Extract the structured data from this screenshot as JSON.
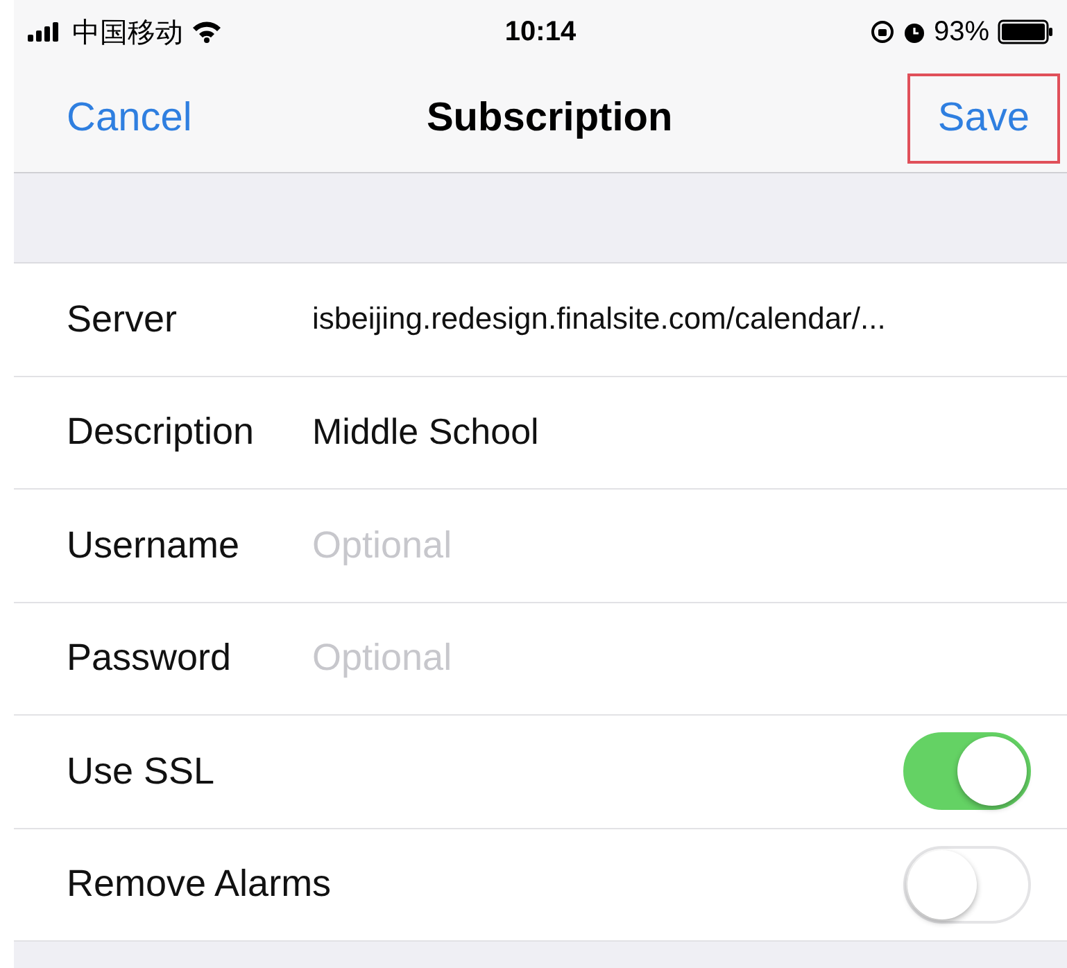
{
  "status_bar": {
    "carrier": "中国移动",
    "time": "10:14",
    "battery": "93%"
  },
  "nav": {
    "cancel": "Cancel",
    "title": "Subscription",
    "save": {
      "label": "Save",
      "highlighted": true
    }
  },
  "rows": [
    {
      "kind": "text",
      "label": "Server",
      "value": "isbeijing.redesign.finalsite.com/calendar/..."
    },
    {
      "kind": "text",
      "label": "Description",
      "value": "Middle School"
    },
    {
      "kind": "text",
      "label": "Username",
      "placeholder": "Optional"
    },
    {
      "kind": "text",
      "label": "Password",
      "placeholder": "Optional"
    },
    {
      "kind": "toggle",
      "label": "Use SSL",
      "on": true
    },
    {
      "kind": "toggle",
      "label": "Remove Alarms",
      "on": false
    }
  ]
}
